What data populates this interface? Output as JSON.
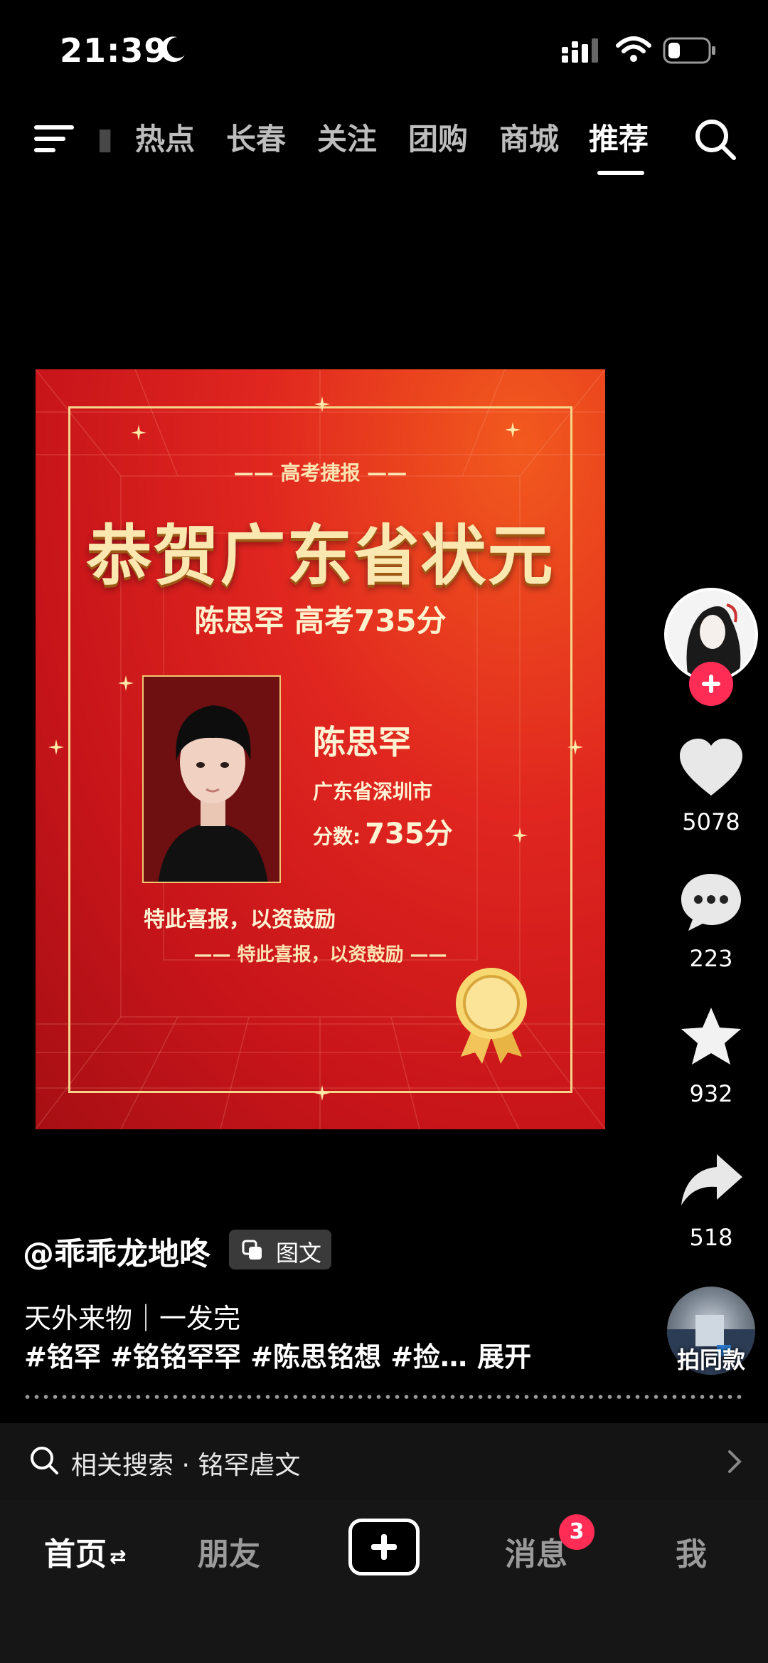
{
  "status_bar": {
    "time": "21:39"
  },
  "top_nav": {
    "tabs": [
      {
        "label": "热点"
      },
      {
        "label": "长春"
      },
      {
        "label": "关注"
      },
      {
        "label": "团购"
      },
      {
        "label": "商城"
      },
      {
        "label": "推荐",
        "active": true
      }
    ]
  },
  "poster": {
    "header": "—— 高考捷报 ——",
    "title": "恭贺广东省状元",
    "score_line": "陈思罕 高考735分",
    "name": "陈思罕",
    "city": "广东省深圳市",
    "score_label": "分数:",
    "score_value": "735分",
    "note": "特此喜报，以资鼓励",
    "note2": "—— 特此喜报，以资鼓励 ——"
  },
  "rail": {
    "likes": "5078",
    "comments": "223",
    "favorites": "932",
    "shares": "518",
    "same_style": "拍同款"
  },
  "caption": {
    "author": "@乖乖龙地咚",
    "badge": "图文",
    "line1": "天外来物｜一发完",
    "tags": "#铭罕 #铭铭罕罕 #陈思铭想 #捡…",
    "expand": "展开"
  },
  "related_search": {
    "text": "相关搜索 · 铭罕虐文"
  },
  "bottom_nav": {
    "home": "首页",
    "friends": "朋友",
    "messages": "消息",
    "messages_badge": "3",
    "me": "我"
  },
  "colors": {
    "accent": "#ff2d55",
    "poster_red": "#d81f1c",
    "poster_gold": "#f5d58a"
  }
}
